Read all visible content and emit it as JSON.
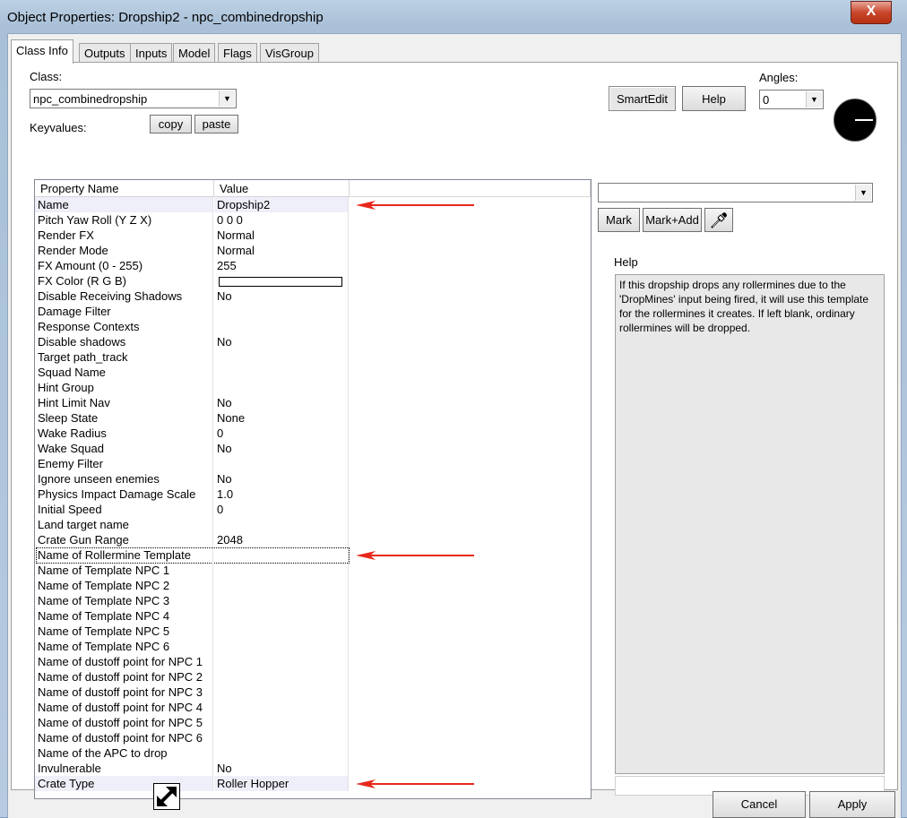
{
  "window": {
    "title": "Object Properties: Dropship2 - npc_combinedropship",
    "close_label": "X"
  },
  "tabs": [
    {
      "label": "Class Info",
      "active": true
    },
    {
      "label": "Outputs",
      "active": false
    },
    {
      "label": "Inputs",
      "active": false
    },
    {
      "label": "Model",
      "active": false
    },
    {
      "label": "Flags",
      "active": false
    },
    {
      "label": "VisGroup",
      "active": false
    }
  ],
  "class_info": {
    "class_label": "Class:",
    "class_value": "npc_combinedropship",
    "keyvalues_label": "Keyvalues:",
    "copy_label": "copy",
    "paste_label": "paste",
    "smartedit_label": "SmartEdit",
    "help_label": "Help",
    "angles_label": "Angles:",
    "angles_value": "0"
  },
  "grid": {
    "col_property": "Property Name",
    "col_value": "Value",
    "rows": [
      {
        "name": "Name",
        "value": "Dropship2",
        "highlight": true,
        "arrow": true
      },
      {
        "name": "Pitch Yaw Roll (Y Z X)",
        "value": "0 0 0"
      },
      {
        "name": "Render FX",
        "value": "Normal"
      },
      {
        "name": "Render Mode",
        "value": "Normal"
      },
      {
        "name": "FX Amount (0 - 255)",
        "value": "255"
      },
      {
        "name": "FX Color (R G B)",
        "value": "",
        "swatch": true
      },
      {
        "name": "Disable Receiving Shadows",
        "value": "No"
      },
      {
        "name": "Damage Filter",
        "value": ""
      },
      {
        "name": "Response Contexts",
        "value": ""
      },
      {
        "name": "Disable shadows",
        "value": "No"
      },
      {
        "name": "Target path_track",
        "value": ""
      },
      {
        "name": "Squad Name",
        "value": ""
      },
      {
        "name": "Hint Group",
        "value": ""
      },
      {
        "name": "Hint Limit Nav",
        "value": "No"
      },
      {
        "name": "Sleep State",
        "value": "None"
      },
      {
        "name": "Wake Radius",
        "value": "0"
      },
      {
        "name": "Wake Squad",
        "value": "No"
      },
      {
        "name": "Enemy Filter",
        "value": ""
      },
      {
        "name": "Ignore unseen enemies",
        "value": "No"
      },
      {
        "name": "Physics Impact Damage Scale",
        "value": "1.0"
      },
      {
        "name": "Initial Speed",
        "value": "0"
      },
      {
        "name": "Land target name",
        "value": ""
      },
      {
        "name": "Crate Gun Range",
        "value": "2048"
      },
      {
        "name": "Name of Rollermine Template",
        "value": "",
        "focus": true,
        "arrow": true
      },
      {
        "name": "Name of Template NPC 1",
        "value": ""
      },
      {
        "name": "Name of Template NPC 2",
        "value": ""
      },
      {
        "name": "Name of Template NPC 3",
        "value": ""
      },
      {
        "name": "Name of Template NPC 4",
        "value": ""
      },
      {
        "name": "Name of Template NPC 5",
        "value": ""
      },
      {
        "name": "Name of Template NPC 6",
        "value": ""
      },
      {
        "name": "Name of dustoff point for NPC 1",
        "value": ""
      },
      {
        "name": "Name of dustoff point for NPC 2",
        "value": ""
      },
      {
        "name": "Name of dustoff point for NPC 3",
        "value": ""
      },
      {
        "name": "Name of dustoff point for NPC 4",
        "value": ""
      },
      {
        "name": "Name of dustoff point for NPC 5",
        "value": ""
      },
      {
        "name": "Name of dustoff point for NPC 6",
        "value": ""
      },
      {
        "name": "Name of the APC to drop",
        "value": ""
      },
      {
        "name": "Invulnerable",
        "value": "No"
      },
      {
        "name": "Crate Type",
        "value": "Roller Hopper",
        "highlight": true,
        "arrow": true
      }
    ]
  },
  "right_panel": {
    "value_combo": "",
    "mark_label": "Mark",
    "mark_add_label": "Mark+Add",
    "help_heading": "Help",
    "help_text": "If this dropship drops any rollermines due to the 'DropMines' input being fired, it will use this template for the rollermines it creates. If left blank, ordinary rollermines will be dropped."
  },
  "footer": {
    "cancel_label": "Cancel",
    "apply_label": "Apply"
  },
  "colors": {
    "annotation_arrow": "#e8281c",
    "row_highlight": "#efeffa"
  }
}
